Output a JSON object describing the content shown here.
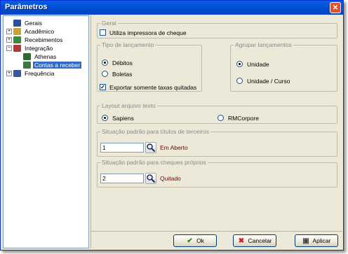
{
  "window": {
    "title": "Parâmetros"
  },
  "tree": {
    "items": [
      {
        "label": "Gerais",
        "expander": "",
        "icon": "settings-icon",
        "color": "#2d4fa0"
      },
      {
        "label": "Acadêmico",
        "expander": "+",
        "icon": "academic-icon",
        "color": "#c9a23a"
      },
      {
        "label": "Recebimentos",
        "expander": "+",
        "icon": "receipts-icon",
        "color": "#3a8a3a"
      },
      {
        "label": "Integração",
        "expander": "−",
        "icon": "integration-icon",
        "color": "#b03a3a"
      },
      {
        "label": "Athenas",
        "expander": "",
        "icon": "athenas-icon",
        "color": "#2e6b2e"
      },
      {
        "label": "Contas a receber",
        "expander": "",
        "icon": "accounts-icon",
        "color": "#3a7a3a"
      },
      {
        "label": "Frequência",
        "expander": "+",
        "icon": "attendance-icon",
        "color": "#3a56a0"
      }
    ],
    "selected_index": 5
  },
  "geral": {
    "legend": "Geral",
    "printer_check_label": "Utiliza impressora de cheque",
    "printer_check_checked": false
  },
  "tipo": {
    "legend": "Tipo de lançamento",
    "options": [
      "Débitos",
      "Boletas"
    ],
    "selected_index": 0,
    "export_label": "Exportar somente taxas quitadas",
    "export_checked": true,
    "check_mark": "✓"
  },
  "agrupar": {
    "legend": "Agrupar lançamentos",
    "options": [
      "Unidade",
      "Unidade / Curso"
    ],
    "selected_index": 0
  },
  "layout": {
    "legend": "Layout arquivo texto",
    "options": [
      "Sapiens",
      "RMCorpore"
    ],
    "selected_index": 0
  },
  "terceiros": {
    "legend": "Situação padrão para títulos de terceiros",
    "value": "1",
    "status": "Em Aberto"
  },
  "cheques": {
    "legend": "Situação padrão para cheques próprios",
    "value": "2",
    "status": "Quitado"
  },
  "buttons": {
    "ok": "Ok",
    "cancel": "Cancelar",
    "apply": "Aplicar"
  }
}
